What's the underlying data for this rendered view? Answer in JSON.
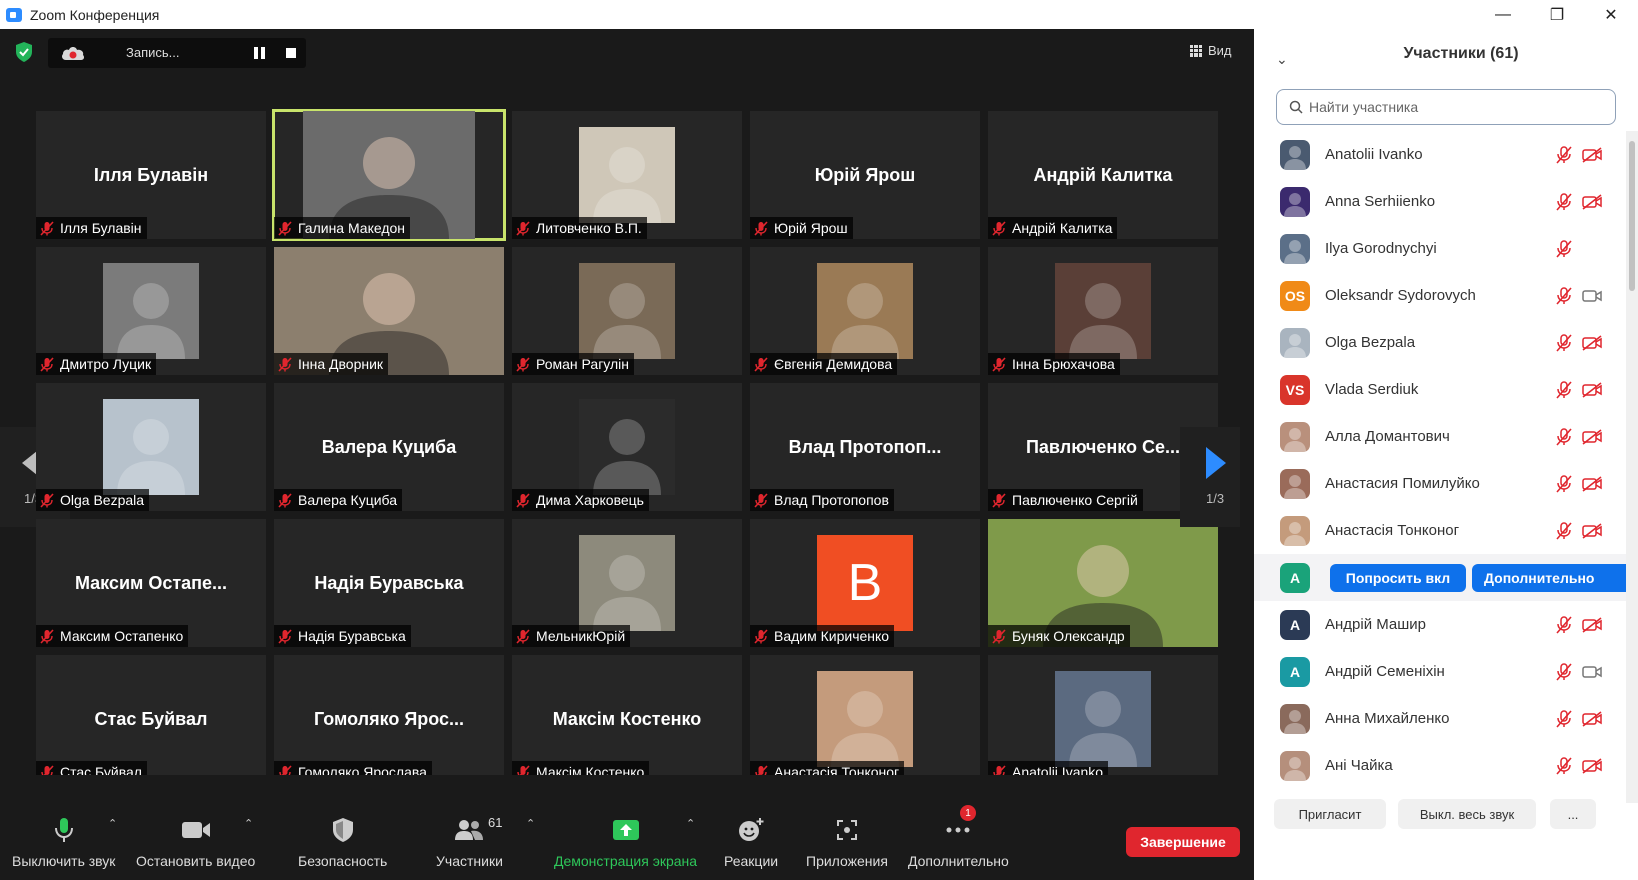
{
  "window": {
    "title": "Zoom Конференция",
    "minimize": "—",
    "restore": "❐",
    "close": "✕"
  },
  "topbar": {
    "recording_text": "Запись...",
    "view_label": "Вид"
  },
  "pagination": {
    "left": "1/3",
    "right": "1/3"
  },
  "tiles": [
    {
      "big": "Ілля Булавін",
      "label": "Ілля Булавін",
      "type": "name"
    },
    {
      "big": "",
      "label": "Галина Македон",
      "type": "video",
      "color": "#6b6b6b",
      "active": true
    },
    {
      "big": "",
      "label": "Литовченко В.П.",
      "type": "photo",
      "color": "#cfc7b8"
    },
    {
      "big": "Юрій Ярош",
      "label": "Юрій Ярош",
      "type": "name"
    },
    {
      "big": "Андрій Калитка",
      "label": "Андрій Калитка",
      "type": "name"
    },
    {
      "big": "",
      "label": "Дмитро Луцик",
      "type": "photo",
      "color": "#7b7b7b"
    },
    {
      "big": "",
      "label": "Інна Дворник",
      "type": "video",
      "color": "#8c7f6e"
    },
    {
      "big": "",
      "label": "Роман Рагулін",
      "type": "photo",
      "color": "#7a6a57"
    },
    {
      "big": "",
      "label": "Євгенія Демидова",
      "type": "photo",
      "color": "#9a7a55"
    },
    {
      "big": "",
      "label": "Інна Брюхачова",
      "type": "photo",
      "color": "#5a3f37"
    },
    {
      "big": "",
      "label": "Olga Bezpala",
      "type": "photo",
      "color": "#b7c2cc"
    },
    {
      "big": "Валера Куциба",
      "label": "Валера Куциба",
      "type": "name"
    },
    {
      "big": "",
      "label": "Дима Харковець",
      "type": "photo",
      "color": "#2b2b2b"
    },
    {
      "big": "Влад  Протопоп...",
      "label": "Влад Протопопов",
      "type": "name"
    },
    {
      "big": "Павлюченко  Се...",
      "label": "Павлюченко Сергій",
      "type": "name"
    },
    {
      "big": "Максим  Остапе...",
      "label": "Максим Остапенко",
      "type": "name"
    },
    {
      "big": "Надія Буравська",
      "label": "Надія Буравська",
      "type": "name"
    },
    {
      "big": "",
      "label": "МельникЮрій",
      "type": "photo",
      "color": "#8d8a7c"
    },
    {
      "big": "B",
      "label": "Вадим Кириченко",
      "type": "letter",
      "color": "#f04e23"
    },
    {
      "big": "",
      "label": "Буняк Олександр",
      "type": "video",
      "color": "#7f9a4a"
    },
    {
      "big": "Стас Буйвал",
      "label": "Стас Буйвал",
      "type": "name"
    },
    {
      "big": "Гомоляко  Ярос...",
      "label": "Гомоляко Ярослава",
      "type": "name"
    },
    {
      "big": "Максім Костенко",
      "label": "Максім Костенко",
      "type": "name"
    },
    {
      "big": "",
      "label": "Анастасія Тонконог",
      "type": "photo",
      "color": "#c49b7c"
    },
    {
      "big": "",
      "label": "Anatolii Ivanko",
      "type": "photo",
      "color": "#5b6a80"
    }
  ],
  "toolbar": {
    "mute": "Выключить звук",
    "video": "Остановить видео",
    "security": "Безопасность",
    "participants": "Участники",
    "participants_count": "61",
    "share": "Демонстрация экрана",
    "reactions": "Реакции",
    "apps": "Приложения",
    "more": "Дополнительно",
    "more_badge": "1",
    "end": "Завершение"
  },
  "panel": {
    "title": "Участники (61)",
    "search_placeholder": "Найти участника",
    "participants": [
      {
        "name": "Anatolii Ivanko",
        "avatar": "photo",
        "color": "#4a5a70",
        "mic": "muted",
        "video": "off"
      },
      {
        "name": "Anna Serhiienko",
        "avatar": "photo",
        "color": "#3b2a6e",
        "mic": "muted",
        "video": "off"
      },
      {
        "name": "Ilya Gorodnychyi",
        "avatar": "photo",
        "color": "#5b6f88",
        "mic": "muted",
        "video": "none"
      },
      {
        "name": "Oleksandr Sydorovych",
        "avatar": "initials",
        "initials": "OS",
        "color": "#f08a17",
        "mic": "muted",
        "video": "on"
      },
      {
        "name": "Olga Bezpala",
        "avatar": "photo",
        "color": "#a9b4bf",
        "mic": "muted",
        "video": "off"
      },
      {
        "name": "Vlada Serdiuk",
        "avatar": "initials",
        "initials": "VS",
        "color": "#d9352b",
        "mic": "muted",
        "video": "off"
      },
      {
        "name": "Алла Домантович",
        "avatar": "photo",
        "color": "#b9907c",
        "mic": "muted",
        "video": "off"
      },
      {
        "name": "Анастасия Помилуйко",
        "avatar": "photo",
        "color": "#9a6b5a",
        "mic": "muted",
        "video": "off"
      },
      {
        "name": "Анастасія Тонконог",
        "avatar": "photo",
        "color": "#c49b7c",
        "mic": "muted",
        "video": "off"
      },
      {
        "name": "",
        "avatar": "initials",
        "initials": "A",
        "color": "#1aa37a",
        "mic": "none",
        "video": "none",
        "hover": true,
        "ask_btn": "Попросить вкл",
        "more_btn": "Дополнительно"
      },
      {
        "name": "Андрій Машир",
        "avatar": "initials",
        "initials": "A",
        "color": "#2b3a55",
        "mic": "muted",
        "video": "off"
      },
      {
        "name": "Андрій Семеніхін",
        "avatar": "initials",
        "initials": "A",
        "color": "#1a9aa3",
        "mic": "muted",
        "video": "on"
      },
      {
        "name": "Анна Михайленко",
        "avatar": "photo",
        "color": "#8a6a5c",
        "mic": "muted",
        "video": "off"
      },
      {
        "name": "Ані Чайка",
        "avatar": "photo",
        "color": "#b58f7c",
        "mic": "muted",
        "video": "off"
      }
    ],
    "footer": {
      "invite": "Пригласит",
      "mute_all": "Выкл. весь звук",
      "more": "..."
    }
  },
  "colors": {
    "accent": "#2d8cff",
    "active_speaker": "#c8e36b",
    "end_red": "#e0262e",
    "share_green": "#2ec75a",
    "muted_red": "#e0262e"
  }
}
